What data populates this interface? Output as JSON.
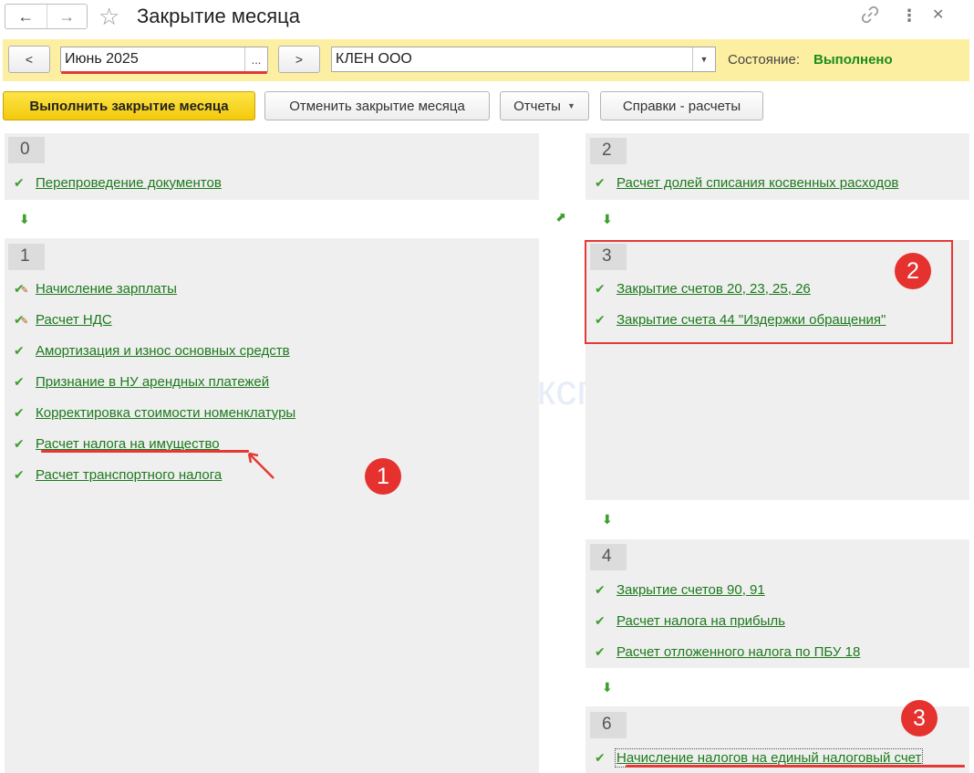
{
  "window": {
    "title": "Закрытие месяца",
    "icons": {
      "back": "arrow-left-icon",
      "forward": "arrow-right-icon",
      "favorite": "star-icon",
      "link": "link-icon",
      "more": "more-vertical-icon",
      "close": "close-icon"
    }
  },
  "params": {
    "prev_label": "<",
    "next_label": ">",
    "period_value": "Июнь 2025",
    "period_btn": "...",
    "org_value": "КЛЕН ООО",
    "state_label": "Состояние:",
    "state_value": "Выполнено",
    "state_color": "#1a8c1a"
  },
  "toolbar": {
    "run": "Выполнить закрытие месяца",
    "cancel": "Отменить закрытие месяца",
    "reports": "Отчеты",
    "calcs": "Справки - расчеты"
  },
  "stages": {
    "s0": {
      "number": "0",
      "items": [
        "Перепроведение документов"
      ]
    },
    "s1": {
      "number": "1",
      "items": [
        "Начисление зарплаты",
        "Расчет НДС",
        "Амортизация и износ основных средств",
        "Признание в НУ арендных платежей",
        "Корректировка стоимости номенклатуры",
        "Расчет налога на имущество",
        "Расчет транспортного налога"
      ]
    },
    "s2": {
      "number": "2",
      "items": [
        "Расчет долей списания косвенных расходов"
      ]
    },
    "s3": {
      "number": "3",
      "items": [
        "Закрытие счетов 20, 23, 25, 26",
        "Закрытие счета 44 \"Издержки обращения\""
      ]
    },
    "s4": {
      "number": "4",
      "items": [
        "Закрытие счетов 90, 91",
        "Расчет налога на прибыль",
        "Расчет отложенного налога по ПБУ 18"
      ]
    },
    "s6": {
      "number": "6",
      "items": [
        "Начисление налогов на единый налоговый счет"
      ]
    }
  },
  "annotations": {
    "a1": "1",
    "a2": "2",
    "a3": "3"
  },
  "watermark": {
    "text": "Бухэксперт"
  },
  "colors": {
    "accent_yellow": "#f6d21c",
    "link_green": "#1d7a1d",
    "check_green": "#3e9f2c",
    "annotation_red": "#e53935"
  }
}
